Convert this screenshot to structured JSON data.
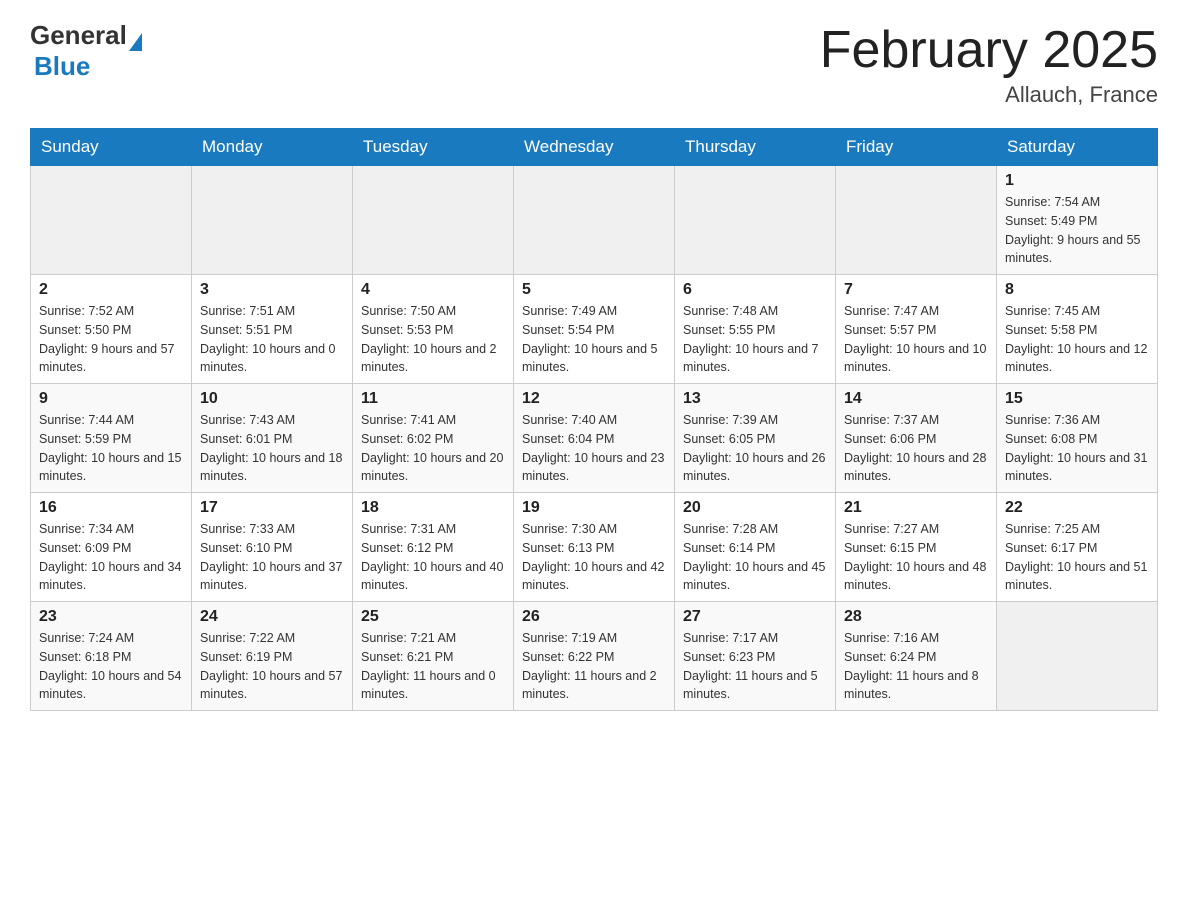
{
  "header": {
    "logo": {
      "general": "General",
      "blue": "Blue"
    },
    "title": "February 2025",
    "location": "Allauch, France"
  },
  "days_of_week": [
    "Sunday",
    "Monday",
    "Tuesday",
    "Wednesday",
    "Thursday",
    "Friday",
    "Saturday"
  ],
  "weeks": [
    [
      {
        "day": "",
        "info": ""
      },
      {
        "day": "",
        "info": ""
      },
      {
        "day": "",
        "info": ""
      },
      {
        "day": "",
        "info": ""
      },
      {
        "day": "",
        "info": ""
      },
      {
        "day": "",
        "info": ""
      },
      {
        "day": "1",
        "info": "Sunrise: 7:54 AM\nSunset: 5:49 PM\nDaylight: 9 hours and 55 minutes."
      }
    ],
    [
      {
        "day": "2",
        "info": "Sunrise: 7:52 AM\nSunset: 5:50 PM\nDaylight: 9 hours and 57 minutes."
      },
      {
        "day": "3",
        "info": "Sunrise: 7:51 AM\nSunset: 5:51 PM\nDaylight: 10 hours and 0 minutes."
      },
      {
        "day": "4",
        "info": "Sunrise: 7:50 AM\nSunset: 5:53 PM\nDaylight: 10 hours and 2 minutes."
      },
      {
        "day": "5",
        "info": "Sunrise: 7:49 AM\nSunset: 5:54 PM\nDaylight: 10 hours and 5 minutes."
      },
      {
        "day": "6",
        "info": "Sunrise: 7:48 AM\nSunset: 5:55 PM\nDaylight: 10 hours and 7 minutes."
      },
      {
        "day": "7",
        "info": "Sunrise: 7:47 AM\nSunset: 5:57 PM\nDaylight: 10 hours and 10 minutes."
      },
      {
        "day": "8",
        "info": "Sunrise: 7:45 AM\nSunset: 5:58 PM\nDaylight: 10 hours and 12 minutes."
      }
    ],
    [
      {
        "day": "9",
        "info": "Sunrise: 7:44 AM\nSunset: 5:59 PM\nDaylight: 10 hours and 15 minutes."
      },
      {
        "day": "10",
        "info": "Sunrise: 7:43 AM\nSunset: 6:01 PM\nDaylight: 10 hours and 18 minutes."
      },
      {
        "day": "11",
        "info": "Sunrise: 7:41 AM\nSunset: 6:02 PM\nDaylight: 10 hours and 20 minutes."
      },
      {
        "day": "12",
        "info": "Sunrise: 7:40 AM\nSunset: 6:04 PM\nDaylight: 10 hours and 23 minutes."
      },
      {
        "day": "13",
        "info": "Sunrise: 7:39 AM\nSunset: 6:05 PM\nDaylight: 10 hours and 26 minutes."
      },
      {
        "day": "14",
        "info": "Sunrise: 7:37 AM\nSunset: 6:06 PM\nDaylight: 10 hours and 28 minutes."
      },
      {
        "day": "15",
        "info": "Sunrise: 7:36 AM\nSunset: 6:08 PM\nDaylight: 10 hours and 31 minutes."
      }
    ],
    [
      {
        "day": "16",
        "info": "Sunrise: 7:34 AM\nSunset: 6:09 PM\nDaylight: 10 hours and 34 minutes."
      },
      {
        "day": "17",
        "info": "Sunrise: 7:33 AM\nSunset: 6:10 PM\nDaylight: 10 hours and 37 minutes."
      },
      {
        "day": "18",
        "info": "Sunrise: 7:31 AM\nSunset: 6:12 PM\nDaylight: 10 hours and 40 minutes."
      },
      {
        "day": "19",
        "info": "Sunrise: 7:30 AM\nSunset: 6:13 PM\nDaylight: 10 hours and 42 minutes."
      },
      {
        "day": "20",
        "info": "Sunrise: 7:28 AM\nSunset: 6:14 PM\nDaylight: 10 hours and 45 minutes."
      },
      {
        "day": "21",
        "info": "Sunrise: 7:27 AM\nSunset: 6:15 PM\nDaylight: 10 hours and 48 minutes."
      },
      {
        "day": "22",
        "info": "Sunrise: 7:25 AM\nSunset: 6:17 PM\nDaylight: 10 hours and 51 minutes."
      }
    ],
    [
      {
        "day": "23",
        "info": "Sunrise: 7:24 AM\nSunset: 6:18 PM\nDaylight: 10 hours and 54 minutes."
      },
      {
        "day": "24",
        "info": "Sunrise: 7:22 AM\nSunset: 6:19 PM\nDaylight: 10 hours and 57 minutes."
      },
      {
        "day": "25",
        "info": "Sunrise: 7:21 AM\nSunset: 6:21 PM\nDaylight: 11 hours and 0 minutes."
      },
      {
        "day": "26",
        "info": "Sunrise: 7:19 AM\nSunset: 6:22 PM\nDaylight: 11 hours and 2 minutes."
      },
      {
        "day": "27",
        "info": "Sunrise: 7:17 AM\nSunset: 6:23 PM\nDaylight: 11 hours and 5 minutes."
      },
      {
        "day": "28",
        "info": "Sunrise: 7:16 AM\nSunset: 6:24 PM\nDaylight: 11 hours and 8 minutes."
      },
      {
        "day": "",
        "info": ""
      }
    ]
  ]
}
